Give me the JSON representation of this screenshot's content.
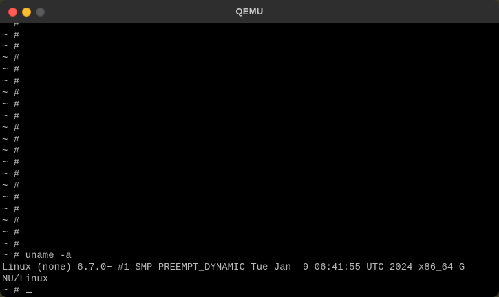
{
  "window": {
    "title": "QEMU"
  },
  "console": {
    "empty_prompt_lines": [
      "~ #",
      "~ #",
      "~ #",
      "~ #",
      "~ #",
      "~ #",
      "~ #",
      "~ #",
      "~ #",
      "~ #",
      "~ #",
      "~ #",
      "~ #",
      "~ #",
      "~ #",
      "~ #",
      "~ #",
      "~ #",
      "~ #",
      "~ #"
    ],
    "command_line": "~ # uname -a",
    "output_line_1": "Linux (none) 6.7.0+ #1 SMP PREEMPT_DYNAMIC Tue Jan  9 06:41:55 UTC 2024 x86_64 G",
    "output_line_2": "NU/Linux",
    "current_prompt": "~ # "
  },
  "colors": {
    "close": "#ff5f57",
    "minimize": "#febc2e",
    "zoom": "#5a5a5a",
    "terminal_fg": "#b8b8b8",
    "terminal_bg": "#000000"
  }
}
